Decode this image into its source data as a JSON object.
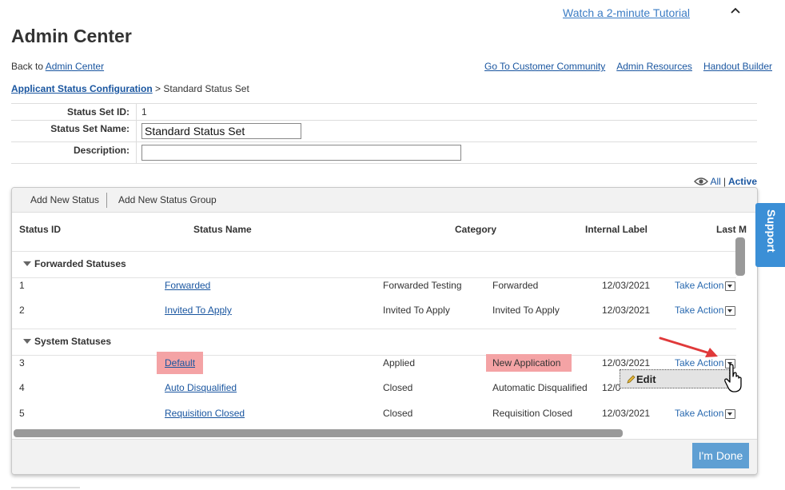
{
  "header": {
    "tutorial_link": "Watch a 2-minute Tutorial",
    "title": "Admin Center",
    "back_prefix": "Back to",
    "back_link": "Admin Center",
    "top_links": [
      "Go To Customer Community",
      "Admin Resources",
      "Handout Builder"
    ]
  },
  "breadcrumb": {
    "parent": "Applicant Status Configuration",
    "separator": ">",
    "current": "Standard Status Set"
  },
  "form": {
    "id_label": "Status Set ID:",
    "id_value": "1",
    "name_label": "Status Set Name:",
    "name_value": "Standard Status Set",
    "desc_label": "Description:",
    "desc_value": ""
  },
  "filter": {
    "all": "All",
    "separator": "|",
    "active": "Active"
  },
  "toolbar": {
    "add_status": "Add New Status",
    "add_group": "Add New Status Group"
  },
  "table": {
    "columns": [
      "Status ID",
      "Status Name",
      "Category",
      "Internal Label",
      "Last M"
    ],
    "groups": [
      {
        "label": "Forwarded Statuses",
        "rows": [
          {
            "id": "1",
            "name": "Forwarded",
            "category": "Forwarded Testing",
            "internal_label": "Forwarded",
            "date": "12/03/2021",
            "action": "Take Action"
          },
          {
            "id": "2",
            "name": "Invited To Apply",
            "category": "Invited To Apply",
            "internal_label": "Invited To Apply",
            "date": "12/03/2021",
            "action": "Take Action"
          }
        ]
      },
      {
        "label": "System Statuses",
        "rows": [
          {
            "id": "3",
            "name": "Default",
            "category": "Applied",
            "internal_label": "New Application",
            "date": "12/03/2021",
            "action": "Take Action"
          },
          {
            "id": "4",
            "name": "Auto Disqualified",
            "category": "Closed",
            "internal_label": "Automatic Disqualified",
            "date": "12/0",
            "action": ""
          },
          {
            "id": "5",
            "name": "Requisition Closed",
            "category": "Closed",
            "internal_label": "Requisition Closed",
            "date": "12/03/2021",
            "action": "Take Action"
          }
        ]
      }
    ]
  },
  "action_menu": {
    "edit": "Edit"
  },
  "footer": {
    "done": "I'm Done"
  },
  "support": "Support",
  "colors": {
    "accent": "#1a56a0",
    "highlight": "#f4a3a5",
    "button": "#5f9fd3",
    "arrow": "#e0393a"
  }
}
